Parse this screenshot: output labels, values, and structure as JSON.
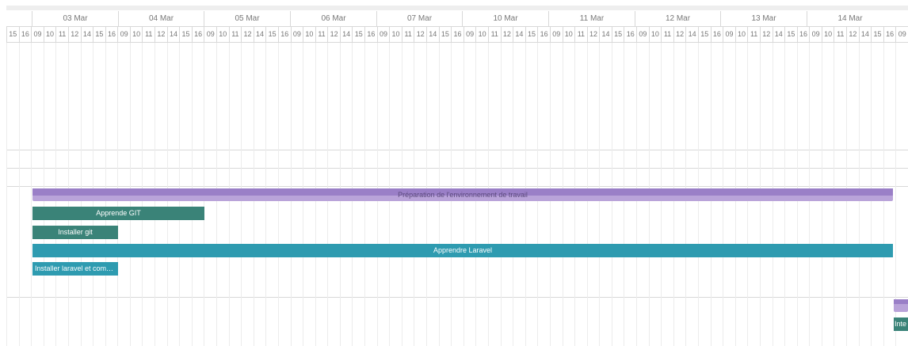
{
  "timeline": {
    "days": [
      "03 Mar",
      "04 Mar",
      "05 Mar",
      "06 Mar",
      "07 Mar",
      "10 Mar",
      "11 Mar",
      "12 Mar",
      "13 Mar",
      "14 Mar"
    ],
    "leading_hours": [
      "15",
      "16"
    ],
    "day_hours": [
      "09",
      "10",
      "11",
      "12",
      "14",
      "15",
      "16"
    ],
    "trailing_hours": [
      "09"
    ]
  },
  "tasks": {
    "parent1": "Préparation de l'environnement de travail",
    "t1": "Apprende GIT",
    "t2": "Installer git",
    "t3": "Apprendre Laravel",
    "t4": "Installer laravel et com…",
    "t5": "Inte"
  },
  "colors": {
    "git": "#3a8378",
    "laravel": "#2e9bb0",
    "parent": "#b9a3d9"
  }
}
